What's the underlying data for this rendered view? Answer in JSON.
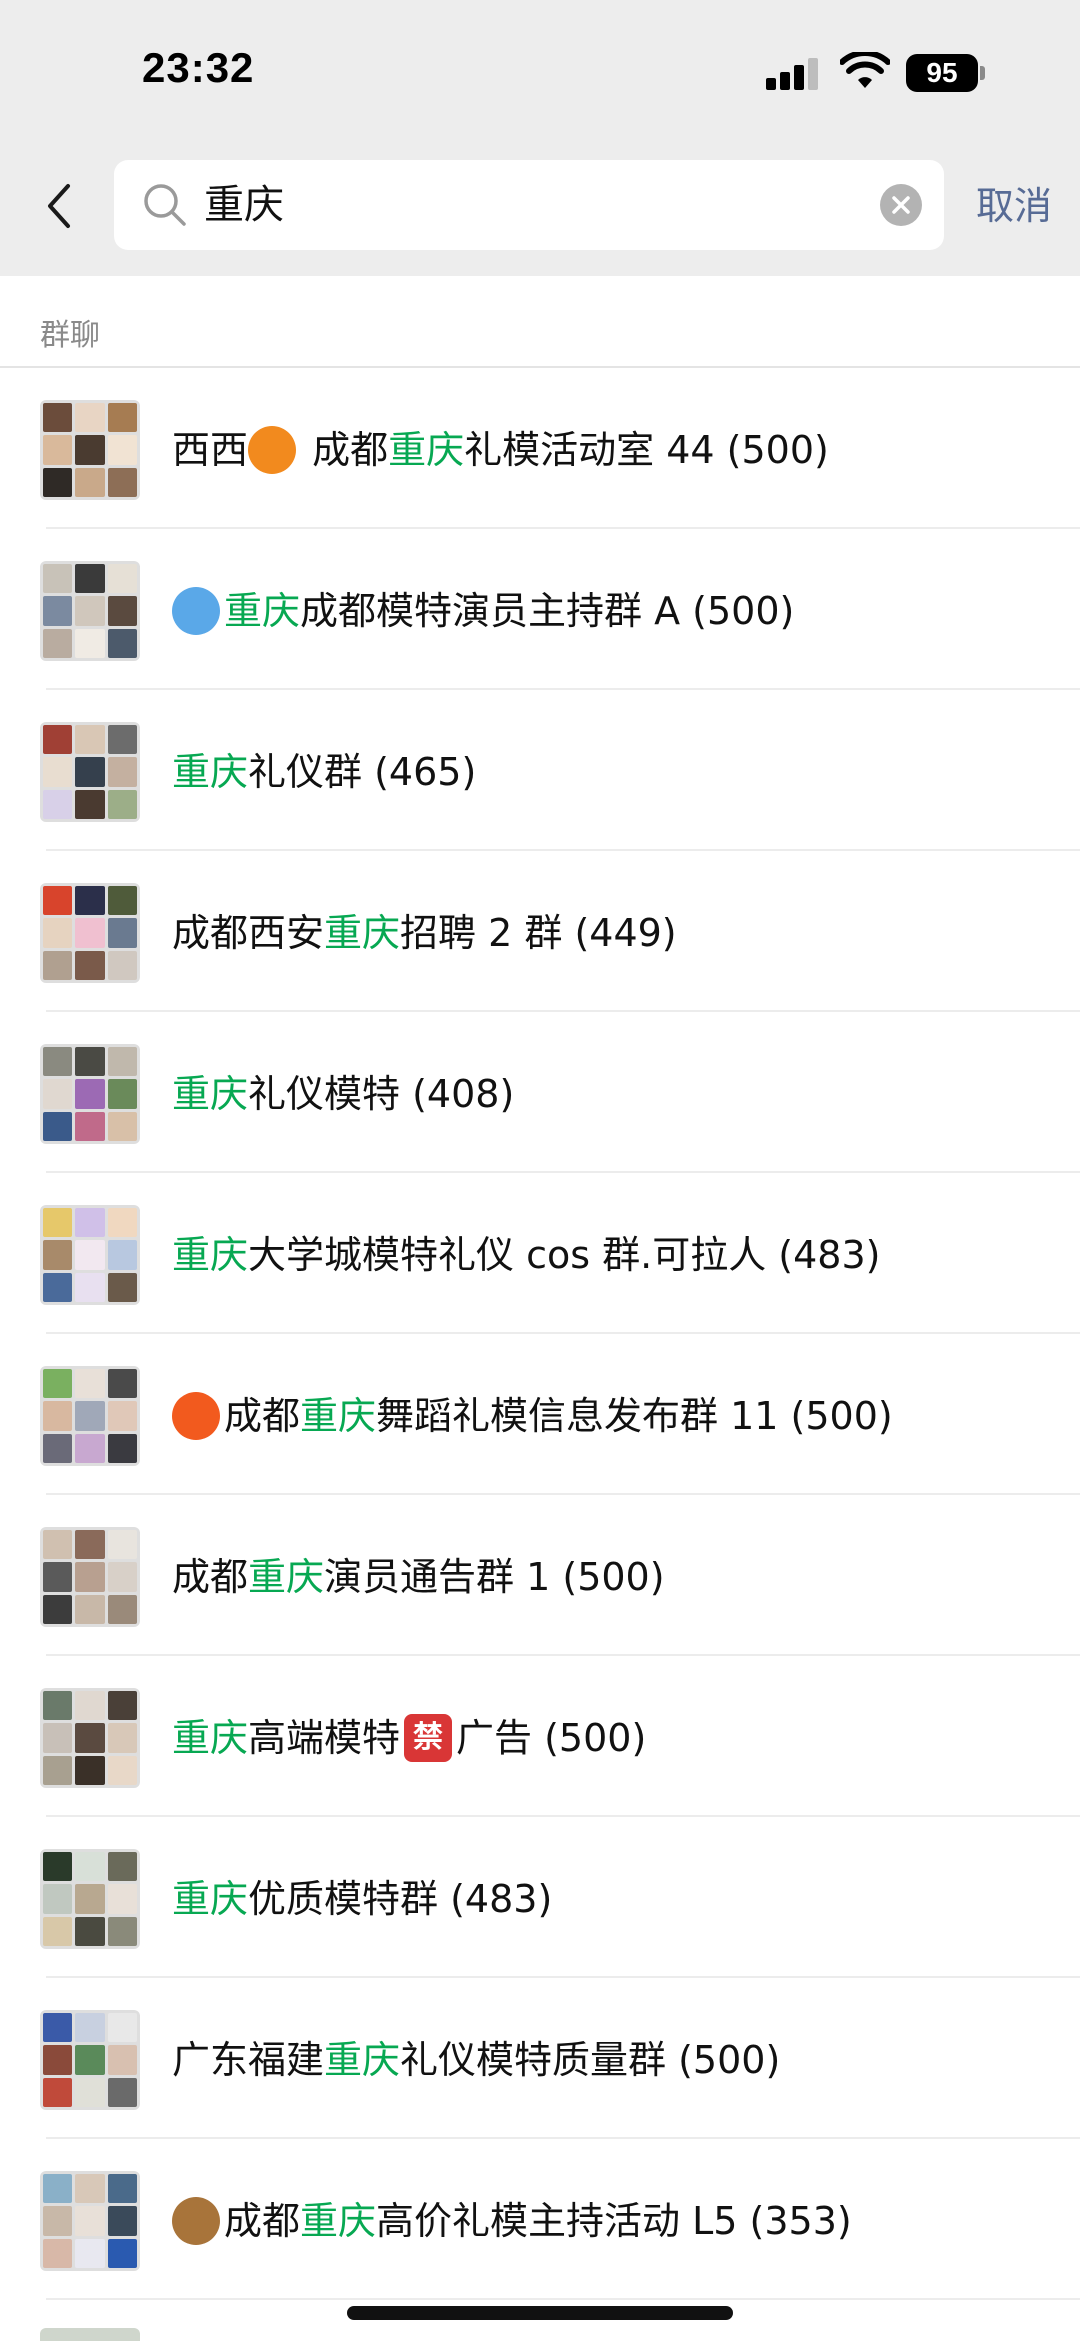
{
  "status_bar": {
    "time": "23:32",
    "battery": "95"
  },
  "search": {
    "query": "重庆",
    "cancel_label": "取消"
  },
  "section": {
    "title": "群聊"
  },
  "colors": {
    "highlight": "#07a852",
    "link": "#576b95",
    "background_top": "#ededed"
  },
  "results": [
    {
      "pre": "西西",
      "icon": "orange-emoji",
      "pre2": " 成都",
      "match": "重庆",
      "post": "礼模活动室 44 (500)"
    },
    {
      "pre": "",
      "icon": "droplets-emoji",
      "pre2": "",
      "match": "重庆",
      "post": "成都模特演员主持群 A (500)"
    },
    {
      "pre": "",
      "icon": "",
      "pre2": "",
      "match": "重庆",
      "post": "礼仪群 (465)"
    },
    {
      "pre": "成都西安",
      "icon": "",
      "pre2": "",
      "match": "重庆",
      "post": "招聘 2 群 (449)"
    },
    {
      "pre": "",
      "icon": "",
      "pre2": "",
      "match": "重庆",
      "post": "礼仪模特 (408)"
    },
    {
      "pre": "",
      "icon": "",
      "pre2": "",
      "match": "重庆",
      "post": "大学城模特礼仪 cos 群.可拉人 (483)"
    },
    {
      "pre": "",
      "icon": "fire-emoji",
      "pre2": "成都",
      "match": "重庆",
      "post": "舞蹈礼模信息发布群 11 (500)"
    },
    {
      "pre": "成都",
      "icon": "",
      "pre2": "",
      "match": "重庆",
      "post": "演员通告群 1 (500)"
    },
    {
      "pre": "",
      "icon": "",
      "pre2": "",
      "match": "重庆",
      "post": "高端模特",
      "ban": "禁",
      "post2": "广告 (500)"
    },
    {
      "pre": "",
      "icon": "",
      "pre2": "",
      "match": "重庆",
      "post": "优质模特群 (483)"
    },
    {
      "pre": "广东福建",
      "icon": "",
      "pre2": "",
      "match": "重庆",
      "post": "礼仪模特质量群 (500)"
    },
    {
      "pre": "",
      "icon": "deer-emoji",
      "pre2": "成都",
      "match": "重庆",
      "post": "高价礼模主持活动 L5 (353)"
    }
  ]
}
